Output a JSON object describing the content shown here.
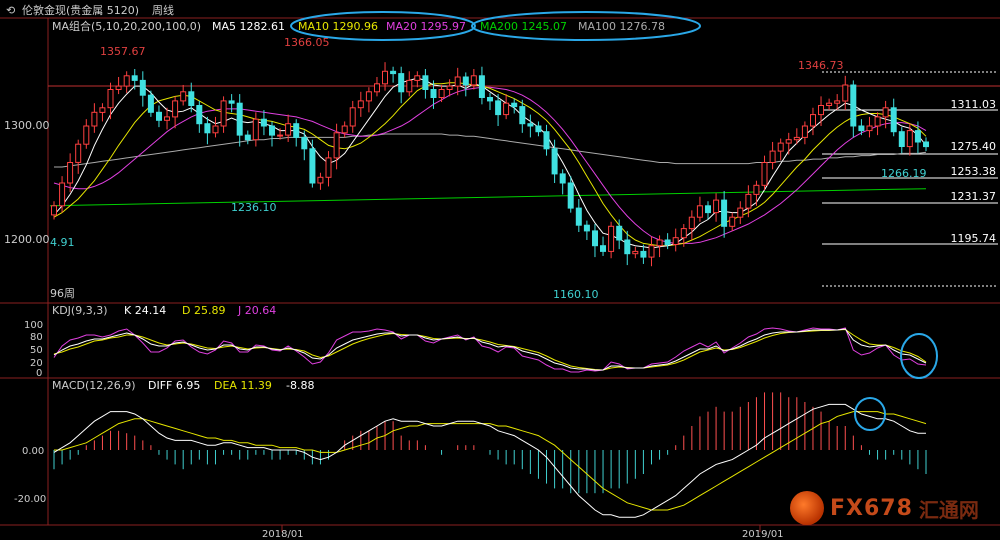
{
  "header": {
    "tool_icon": "back-arrow-icon",
    "instrument": "伦敦金现(贵金属 5120)",
    "period": "周线"
  },
  "legend": {
    "ma_group": "MA组合(5,10,20,200,100,0)",
    "items": [
      {
        "label": "MA5 1282.61",
        "color": "#ffffff"
      },
      {
        "label": "MA10 1290.96",
        "color": "#e6e600"
      },
      {
        "label": "MA20 1295.97",
        "color": "#e040e0"
      },
      {
        "label": "MA200 1245.07",
        "color": "#00d000"
      },
      {
        "label": "MA100 1276.78",
        "color": "#aaaaaa"
      }
    ]
  },
  "kdj_legend": {
    "title": "KDJ(9,3,3)",
    "k": "K 24.14",
    "d": "D 25.89",
    "j": "J 20.64"
  },
  "macd_legend": {
    "title": "MACD(12,26,9)",
    "diff": "DIFF 6.95",
    "dea": "DEA 11.39",
    "macd": "-8.88"
  },
  "chart_data": [
    {
      "type": "candlestick",
      "y_ticks": [
        "1300.00",
        "1200.00"
      ],
      "x_ticks": [
        "2018/01",
        "2019/01"
      ],
      "annotations": [
        "1357.67",
        "1366.05",
        "1346.73",
        "1236.10",
        "1160.10",
        "1266.19",
        "4.91",
        "96周"
      ],
      "levels": [
        "1311.03",
        "1275.40",
        "1253.38",
        "1231.37",
        "1195.74"
      ],
      "ylim": [
        1145,
        1375
      ],
      "close": [
        1230,
        1250,
        1268,
        1284,
        1300,
        1312,
        1316,
        1332,
        1335,
        1344,
        1340,
        1327,
        1312,
        1305,
        1308,
        1322,
        1330,
        1318,
        1302,
        1294,
        1300,
        1322,
        1320,
        1292,
        1288,
        1306,
        1300,
        1292,
        1292,
        1302,
        1290,
        1280,
        1250,
        1255,
        1272,
        1294,
        1300,
        1316,
        1322,
        1330,
        1337,
        1348,
        1346,
        1330,
        1340,
        1344,
        1332,
        1325,
        1332,
        1335,
        1343,
        1336,
        1344,
        1325,
        1322,
        1310,
        1320,
        1317,
        1302,
        1300,
        1295,
        1280,
        1258,
        1250,
        1228,
        1213,
        1208,
        1195,
        1190,
        1212,
        1200,
        1188,
        1190,
        1185,
        1195,
        1200,
        1196,
        1202,
        1210,
        1220,
        1230,
        1224,
        1235,
        1212,
        1220,
        1228,
        1240,
        1248,
        1268,
        1278,
        1285,
        1288,
        1290,
        1300,
        1310,
        1318,
        1320,
        1322,
        1336,
        1300,
        1296,
        1300,
        1308,
        1316,
        1295,
        1282,
        1296,
        1286,
        1282
      ],
      "ma5": [
        1222,
        1230,
        1240,
        1252,
        1266,
        1283,
        1297,
        1310,
        1320,
        1328,
        1335,
        1335,
        1329,
        1321,
        1314,
        1312,
        1313,
        1316,
        1311,
        1306,
        1302,
        1304,
        1307,
        1304,
        1303,
        1304,
        1302,
        1300,
        1296,
        1296,
        1296,
        1293,
        1282,
        1273,
        1267,
        1270,
        1276,
        1286,
        1296,
        1306,
        1316,
        1326,
        1334,
        1338,
        1340,
        1342,
        1340,
        1336,
        1335,
        1335,
        1336,
        1333,
        1337,
        1335,
        1330,
        1325,
        1320,
        1316,
        1309,
        1304,
        1299,
        1292,
        1280,
        1268,
        1255,
        1240,
        1226,
        1215,
        1206,
        1204,
        1201,
        1197,
        1195,
        1194,
        1193,
        1194,
        1195,
        1197,
        1202,
        1207,
        1214,
        1218,
        1225,
        1225,
        1224,
        1224,
        1228,
        1233,
        1244,
        1256,
        1267,
        1278,
        1285,
        1292,
        1298,
        1304,
        1310,
        1315,
        1320,
        1318,
        1314,
        1311,
        1308,
        1306,
        1304,
        1300,
        1298,
        1292,
        1283
      ],
      "ma10": [
        1220,
        1224,
        1230,
        1236,
        1244,
        1252,
        1262,
        1272,
        1283,
        1293,
        1303,
        1311,
        1318,
        1322,
        1324,
        1326,
        1327,
        1326,
        1322,
        1318,
        1314,
        1312,
        1311,
        1310,
        1308,
        1306,
        1305,
        1304,
        1302,
        1300,
        1299,
        1297,
        1293,
        1288,
        1283,
        1281,
        1280,
        1282,
        1285,
        1290,
        1296,
        1302,
        1309,
        1317,
        1324,
        1331,
        1335,
        1337,
        1337,
        1338,
        1338,
        1337,
        1336,
        1335,
        1333,
        1330,
        1327,
        1324,
        1320,
        1316,
        1311,
        1305,
        1297,
        1288,
        1279,
        1268,
        1256,
        1244,
        1232,
        1222,
        1213,
        1205,
        1200,
        1197,
        1196,
        1195,
        1195,
        1196,
        1197,
        1200,
        1203,
        1207,
        1211,
        1215,
        1218,
        1221,
        1224,
        1228,
        1233,
        1240,
        1248,
        1256,
        1264,
        1271,
        1279,
        1286,
        1293,
        1299,
        1304,
        1308,
        1310,
        1311,
        1311,
        1310,
        1308,
        1305,
        1302,
        1298,
        1291
      ],
      "ma20": [
        1250,
        1248,
        1246,
        1245,
        1245,
        1247,
        1250,
        1254,
        1259,
        1265,
        1271,
        1277,
        1283,
        1289,
        1295,
        1300,
        1304,
        1308,
        1311,
        1313,
        1314,
        1315,
        1315,
        1315,
        1314,
        1313,
        1312,
        1311,
        1310,
        1309,
        1308,
        1306,
        1304,
        1301,
        1298,
        1295,
        1293,
        1292,
        1291,
        1291,
        1292,
        1294,
        1297,
        1300,
        1304,
        1309,
        1314,
        1319,
        1323,
        1327,
        1330,
        1332,
        1333,
        1334,
        1334,
        1333,
        1332,
        1330,
        1327,
        1323,
        1318,
        1312,
        1305,
        1297,
        1288,
        1278,
        1268,
        1258,
        1248,
        1238,
        1229,
        1221,
        1214,
        1208,
        1203,
        1200,
        1198,
        1197,
        1197,
        1197,
        1198,
        1200,
        1202,
        1205,
        1208,
        1211,
        1214,
        1218,
        1222,
        1227,
        1232,
        1238,
        1244,
        1251,
        1258,
        1265,
        1272,
        1279,
        1285,
        1290,
        1294,
        1297,
        1300,
        1302,
        1303,
        1303,
        1302,
        1300,
        1296
      ],
      "ma100": [
        1264,
        1264,
        1265,
        1266,
        1267,
        1268,
        1269,
        1270,
        1271,
        1272,
        1273,
        1274,
        1275,
        1276,
        1277,
        1278,
        1279,
        1280,
        1281,
        1282,
        1283,
        1284,
        1285,
        1286,
        1287,
        1288,
        1288,
        1289,
        1289,
        1290,
        1290,
        1290,
        1290,
        1290,
        1290,
        1290,
        1290,
        1291,
        1291,
        1292,
        1292,
        1293,
        1293,
        1293,
        1293,
        1293,
        1293,
        1293,
        1293,
        1292,
        1292,
        1291,
        1291,
        1290,
        1289,
        1288,
        1287,
        1286,
        1285,
        1284,
        1283,
        1282,
        1281,
        1280,
        1279,
        1278,
        1277,
        1276,
        1275,
        1274,
        1273,
        1272,
        1271,
        1270,
        1269,
        1268,
        1268,
        1267,
        1267,
        1267,
        1267,
        1267,
        1267,
        1267,
        1267,
        1267,
        1267,
        1268,
        1268,
        1268,
        1269,
        1269,
        1270,
        1270,
        1271,
        1271,
        1272,
        1272,
        1273,
        1273,
        1274,
        1274,
        1275,
        1275,
        1275,
        1276,
        1276,
        1276,
        1277
      ],
      "ma200_start": 1230,
      "ma200_end": 1245
    },
    {
      "type": "line",
      "name_panel": "KDJ",
      "y_ticks": [
        "100",
        "80",
        "50",
        "20",
        "0"
      ],
      "ylim": [
        0,
        110
      ],
      "k": [
        40,
        50,
        58,
        62,
        68,
        72,
        72,
        76,
        80,
        84,
        80,
        72,
        62,
        58,
        58,
        64,
        66,
        60,
        54,
        50,
        52,
        60,
        60,
        52,
        50,
        56,
        56,
        52,
        50,
        54,
        50,
        44,
        34,
        32,
        40,
        54,
        62,
        70,
        74,
        78,
        82,
        84,
        84,
        78,
        80,
        80,
        74,
        70,
        72,
        74,
        76,
        72,
        74,
        66,
        62,
        56,
        58,
        56,
        48,
        44,
        40,
        32,
        24,
        20,
        14,
        12,
        12,
        10,
        10,
        18,
        18,
        14,
        14,
        14,
        18,
        20,
        22,
        28,
        36,
        44,
        52,
        52,
        58,
        48,
        52,
        58,
        66,
        72,
        80,
        84,
        86,
        86,
        86,
        88,
        90,
        90,
        90,
        90,
        92,
        70,
        60,
        56,
        58,
        60,
        50,
        42,
        40,
        32,
        24
      ],
      "d": [
        42,
        46,
        52,
        56,
        62,
        68,
        70,
        74,
        76,
        80,
        80,
        76,
        70,
        64,
        60,
        62,
        64,
        62,
        58,
        54,
        53,
        56,
        58,
        55,
        52,
        54,
        55,
        53,
        51,
        52,
        51,
        48,
        40,
        35,
        38,
        46,
        54,
        62,
        68,
        73,
        77,
        81,
        83,
        81,
        80,
        80,
        77,
        73,
        72,
        73,
        74,
        73,
        73,
        70,
        66,
        61,
        59,
        57,
        53,
        49,
        45,
        38,
        30,
        24,
        18,
        15,
        13,
        11,
        10,
        14,
        16,
        15,
        14,
        14,
        16,
        18,
        20,
        24,
        30,
        38,
        46,
        50,
        54,
        50,
        51,
        55,
        61,
        67,
        74,
        79,
        83,
        85,
        86,
        87,
        88,
        89,
        89,
        90,
        91,
        80,
        70,
        62,
        60,
        60,
        55,
        48,
        44,
        37,
        26
      ],
      "j": [
        35,
        58,
        70,
        74,
        80,
        80,
        76,
        80,
        88,
        92,
        80,
        64,
        46,
        46,
        54,
        68,
        70,
        56,
        46,
        42,
        50,
        68,
        64,
        46,
        46,
        60,
        58,
        50,
        48,
        58,
        48,
        36,
        22,
        26,
        44,
        70,
        78,
        86,
        86,
        88,
        92,
        90,
        86,
        72,
        80,
        80,
        68,
        64,
        72,
        76,
        80,
        70,
        76,
        58,
        54,
        46,
        56,
        54,
        38,
        34,
        30,
        20,
        12,
        12,
        6,
        6,
        10,
        8,
        10,
        26,
        22,
        12,
        14,
        14,
        22,
        24,
        26,
        36,
        48,
        56,
        64,
        56,
        66,
        44,
        54,
        64,
        76,
        82,
        92,
        94,
        92,
        88,
        86,
        90,
        94,
        92,
        92,
        90,
        94,
        50,
        40,
        44,
        54,
        60,
        40,
        30,
        32,
        22,
        20
      ]
    },
    {
      "type": "bar",
      "name_panel": "MACD",
      "y_ticks": [
        "0.00",
        "-20.00"
      ],
      "ylim": [
        -30,
        22
      ],
      "diff": [
        -1,
        1,
        3,
        6,
        9,
        12,
        14,
        16,
        16,
        16,
        15,
        13,
        10,
        7,
        5,
        4,
        4,
        4,
        3,
        2,
        2,
        3,
        3,
        2,
        1,
        1,
        1,
        0,
        0,
        0,
        0,
        -1,
        -3,
        -4,
        -3,
        -1,
        2,
        4,
        6,
        8,
        10,
        12,
        13,
        12,
        12,
        12,
        11,
        10,
        10,
        11,
        12,
        12,
        12,
        11,
        10,
        8,
        7,
        6,
        4,
        2,
        0,
        -3,
        -7,
        -11,
        -15,
        -19,
        -22,
        -25,
        -27,
        -27,
        -28,
        -28,
        -28,
        -27,
        -25,
        -23,
        -21,
        -19,
        -16,
        -13,
        -10,
        -8,
        -6,
        -5,
        -4,
        -2,
        0,
        2,
        5,
        7,
        9,
        11,
        13,
        15,
        17,
        18,
        19,
        19,
        19,
        17,
        15,
        14,
        13,
        13,
        12,
        10,
        8,
        7,
        7
      ],
      "dea": [
        0,
        0,
        1,
        2,
        3,
        5,
        7,
        9,
        11,
        12,
        13,
        13,
        12,
        11,
        10,
        9,
        8,
        7,
        6,
        5,
        5,
        4,
        4,
        3,
        3,
        2,
        2,
        2,
        1,
        1,
        1,
        0,
        0,
        -1,
        -1,
        -1,
        0,
        1,
        2,
        3,
        5,
        6,
        8,
        9,
        10,
        10,
        11,
        11,
        11,
        11,
        11,
        11,
        11,
        11,
        11,
        10,
        10,
        9,
        8,
        7,
        6,
        4,
        2,
        -1,
        -4,
        -7,
        -10,
        -13,
        -16,
        -18,
        -20,
        -22,
        -23,
        -24,
        -25,
        -25,
        -25,
        -24,
        -23,
        -21,
        -19,
        -17,
        -15,
        -13,
        -11,
        -9,
        -7,
        -5,
        -3,
        -1,
        1,
        3,
        5,
        7,
        9,
        11,
        12,
        14,
        15,
        16,
        16,
        16,
        16,
        15,
        15,
        14,
        13,
        12,
        11
      ],
      "hist": [
        -8,
        -6,
        -4,
        -2,
        2,
        4,
        6,
        8,
        8,
        7,
        6,
        4,
        2,
        -2,
        -4,
        -6,
        -8,
        -6,
        -4,
        -6,
        -6,
        -2,
        -2,
        -4,
        -4,
        -2,
        -2,
        -4,
        -4,
        -2,
        -2,
        -4,
        -6,
        -6,
        -4,
        0,
        4,
        6,
        8,
        8,
        10,
        12,
        12,
        6,
        4,
        4,
        2,
        0,
        -2,
        0,
        2,
        2,
        2,
        0,
        -2,
        -4,
        -6,
        -6,
        -8,
        -10,
        -12,
        -14,
        -16,
        -16,
        -18,
        -18,
        -18,
        -18,
        -18,
        -16,
        -16,
        -14,
        -12,
        -10,
        -6,
        -4,
        -2,
        2,
        6,
        10,
        14,
        16,
        18,
        16,
        16,
        18,
        20,
        22,
        24,
        24,
        24,
        22,
        22,
        20,
        18,
        16,
        12,
        10,
        10,
        6,
        2,
        -2,
        -4,
        -4,
        -2,
        -4,
        -6,
        -8,
        -10
      ]
    }
  ]
}
